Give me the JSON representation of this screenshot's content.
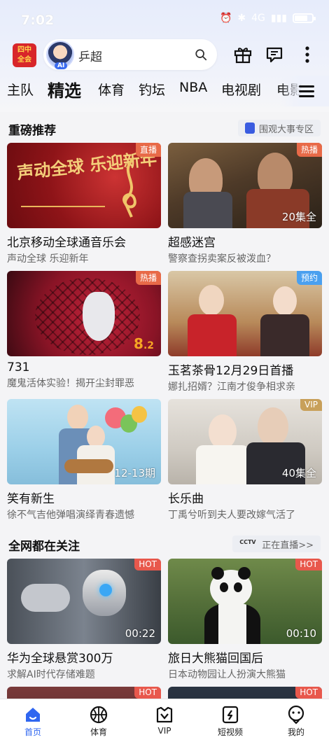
{
  "status": {
    "time": "7:02",
    "signal": "4G"
  },
  "header": {
    "logo_text": "四中全会",
    "ai_tag": "AI",
    "search_value": "乒超",
    "icons": [
      "search-icon",
      "gift-icon",
      "message-icon",
      "more-icon"
    ]
  },
  "tabs": [
    "主队",
    "精选",
    "体育",
    "钓坛",
    "NBA",
    "电视剧",
    "电影"
  ],
  "active_tab": "精选",
  "sections": {
    "featured": {
      "title": "重磅推荐",
      "link": "围观大事专区"
    },
    "trending": {
      "title": "全网都在关注",
      "link": "正在直播>>",
      "link_logo": "CCTV"
    }
  },
  "featured_cards": [
    {
      "title": "北京移动全球通音乐会",
      "subtitle": "声动全球 乐迎新年",
      "badge": "直播",
      "overlay": "",
      "poster_text": "声动全球 乐迎新年"
    },
    {
      "title": "超感迷宫",
      "subtitle": "警察查拐卖案反被泼血？",
      "badge": "热播",
      "overlay": "20集全"
    },
    {
      "title": "731",
      "subtitle": "魔鬼活体实验！揭开尘封罪恶",
      "badge": "热播",
      "rating": "8",
      "rating_dec": ".2"
    },
    {
      "title": "玉茗茶骨12月29日首播",
      "subtitle": "娜扎招婿？江南才俊争相求亲",
      "badge": "预约",
      "overlay": ""
    },
    {
      "title": "笑有新生",
      "subtitle": "徐不气吉他弹唱演绎青春遗憾",
      "badge": "",
      "overlay": "12-13期"
    },
    {
      "title": "长乐曲",
      "subtitle": "丁禹兮听到夫人要改嫁气活了",
      "badge": "VIP",
      "overlay": "40集全"
    }
  ],
  "trending_cards": [
    {
      "title": "华为全球悬赏300万",
      "subtitle": "求解AI时代存储难题",
      "badge": "HOT",
      "overlay": "00:22"
    },
    {
      "title": "旅日大熊猫回国后",
      "subtitle": "日本动物园让人扮演大熊猫",
      "badge": "HOT",
      "overlay": "00:10"
    },
    {
      "badge": "HOT"
    },
    {
      "badge": "HOT"
    }
  ],
  "bottom_nav": [
    {
      "label": "首页",
      "icon": "home-icon",
      "active": true
    },
    {
      "label": "体育",
      "icon": "basketball-icon"
    },
    {
      "label": "VIP",
      "icon": "vip-icon"
    },
    {
      "label": "短视频",
      "icon": "short-video-icon"
    },
    {
      "label": "我的",
      "icon": "profile-icon"
    }
  ],
  "colors": {
    "accent": "#2f66f0",
    "live": "#e86a48",
    "hot": "#e8584c",
    "preorder": "#4aa0ef",
    "vip": "#c8a05a",
    "rating": "#f5a524"
  }
}
